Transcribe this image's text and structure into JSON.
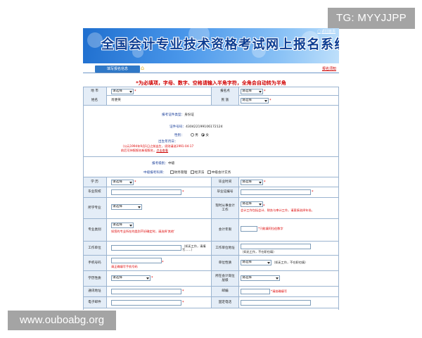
{
  "watermark": {
    "tg": "TG: MYYJJPP",
    "site": "www.ouboabg.org"
  },
  "banner": {
    "title": "全国会计专业技术资格考试网上报名系统",
    "home_link": "返回首页"
  },
  "tabs": {
    "active": "填写报名信息",
    "return_link": "报名须知"
  },
  "notice": "*为必填项，字母、数字、空格请输入半角字符，全角会自动转为半角",
  "form": {
    "area_label": "地 市",
    "area_value": "请选择",
    "site_label": "报名点",
    "site_value": "请选择",
    "name_label": "姓名",
    "name_value": "肖便英",
    "ethnic_label": "民 族",
    "ethnic_value": "请选择",
    "id_type_label": "报考证件类型：",
    "id_type_value": "身份证",
    "id_no_label": "证件号码：",
    "id_no_value": "430422199106172124",
    "gender_label": "性别：",
    "gender_male": "男",
    "gender_female": "女",
    "birth_label": "出生年月日：",
    "birth_hint_1": "（公元1994年9月1日之前出生，须则请选1991-04-17",
    "birth_hint_2": "前后可持报报名新规报名，",
    "birth_hint_link": "点击查看",
    "level_label": "报考级别：",
    "level_value": "中级",
    "subjects_label": "中级报考科目：",
    "subject_1": "财务管理",
    "subject_2": "经济法",
    "subject_3": "中级会计实务",
    "edu_label": "学 历",
    "edu_value": "请选择",
    "grad_time_label": "毕业时间",
    "grad_time_value": "请选择",
    "school_label": "毕业院校",
    "cert_no_label": "毕业证编号",
    "major_label": "所学专业",
    "major_value": "请选择",
    "work_label": "现时从事会计工作",
    "work_value": "请选择",
    "work_hint": "会计工作包括会计、财务与审计工作，请直接选择年份。",
    "major2_label": "专业类别",
    "major2_value": "请选择",
    "major2_hint": "如您的专业所在的类别不好确定时，请选择'其他'",
    "years_label": "会计年限",
    "years_hint": "*只能填阿拉伯数字",
    "employer_label": "工作单位",
    "employer_hint": "（如无工作，请填写……）",
    "employer_addr_label": "工作单位地址",
    "employer_addr_hint": "（如无工作，不在职也填）",
    "phone_label": "手机号码",
    "phone_hint": "请正确填写手机号码",
    "unit_type_label": "单位性质",
    "unit_type_value": "请选择",
    "unit_type_hint": "（如无工作，不在职也填）",
    "degree_label": "学历性质",
    "degree_value": "请选择",
    "title_label": "所在会计岗位层级",
    "title_value": "请选择",
    "address_label": "通讯地址",
    "zip_label": "邮编",
    "zip_hint": "*请准确填写",
    "email_label": "电子邮件",
    "fixed_phone_label": "固定电话"
  }
}
